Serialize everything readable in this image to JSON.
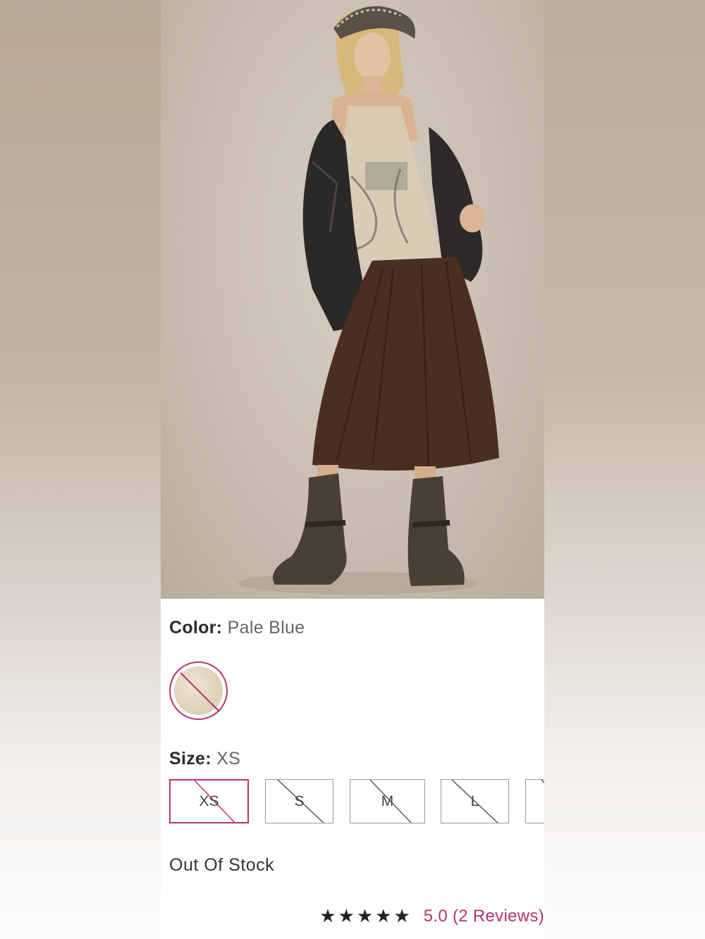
{
  "product": {
    "image_alt": "Model wearing sheer beaded cami, brown midi skirt, leather jacket and boots"
  },
  "color": {
    "label": "Color:",
    "value": "Pale Blue",
    "swatch_color": "#e2d5bd"
  },
  "size": {
    "label": "Size:",
    "value": "XS",
    "options": [
      "XS",
      "S",
      "M",
      "L"
    ]
  },
  "availability": "Out Of Stock",
  "rating": {
    "stars": "★★★★★",
    "text": "5.0 (2 Reviews)"
  },
  "colors": {
    "accent": "#b6356e"
  }
}
